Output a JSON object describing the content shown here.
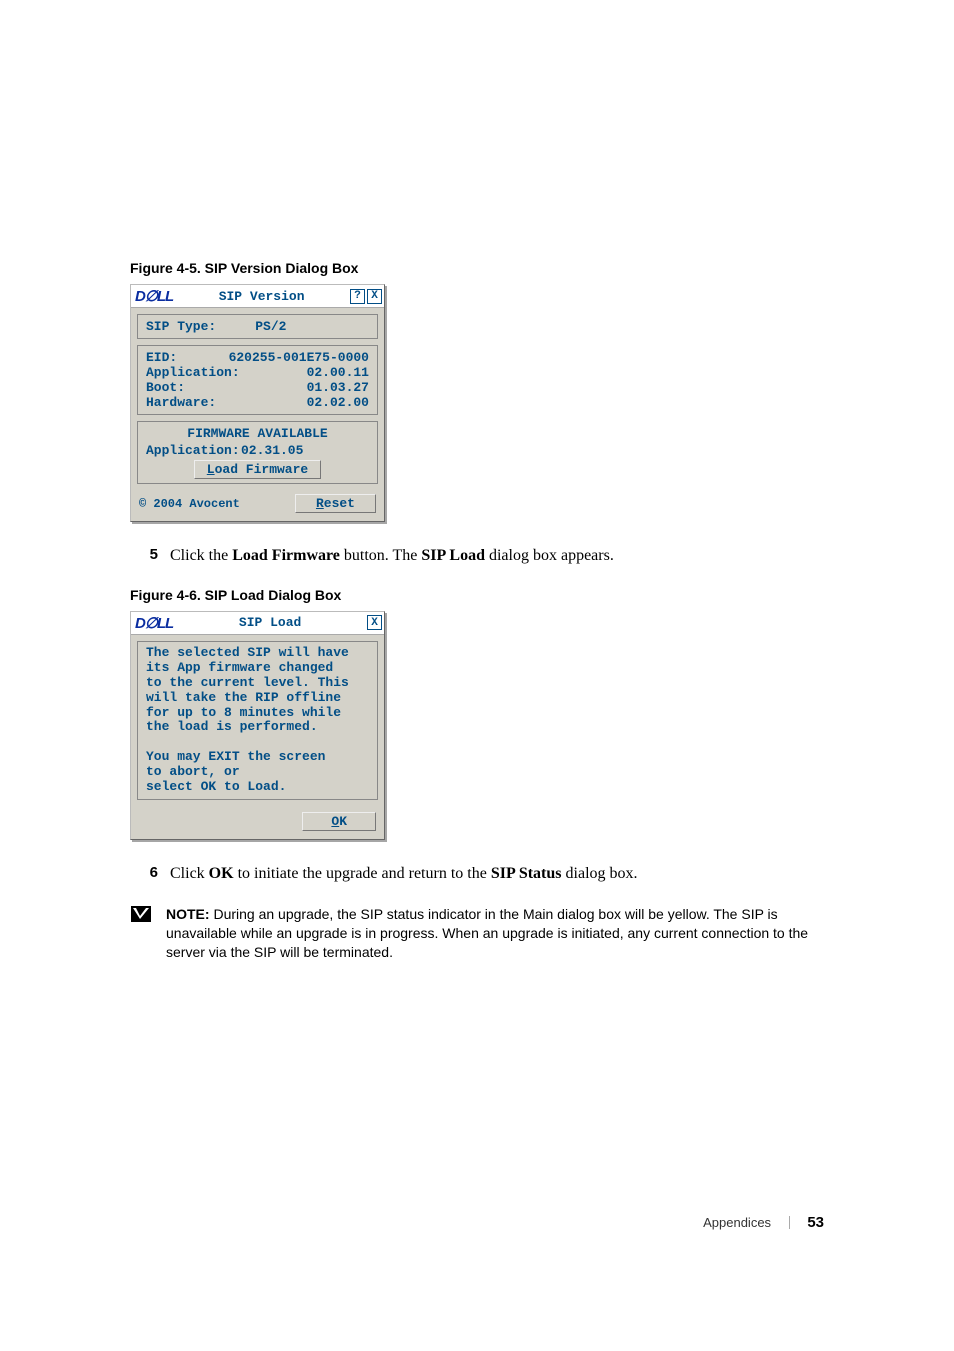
{
  "figure1": {
    "caption": "Figure 4-5.    SIP Version Dialog Box",
    "title": "SIP Version",
    "help_label": "?",
    "close_label": "X",
    "sip_type_label": "SIP Type:",
    "sip_type_value": "PS/2",
    "eid_label": "EID:",
    "eid_value": "620255-001E75-0000",
    "app_label": "Application:",
    "app_value": "02.00.11",
    "boot_label": "Boot:",
    "boot_value": "01.03.27",
    "hw_label": "Hardware:",
    "hw_value": "02.02.00",
    "fw_header": "FIRMWARE AVAILABLE",
    "fw_app_label": "Application:",
    "fw_app_value": "02.31.05",
    "load_btn": "Load Firmware",
    "copyright": "© 2004 Avocent",
    "reset_btn": "Reset"
  },
  "step5": {
    "num": "5",
    "pre": "Click the ",
    "btn": "Load Firmware",
    "mid": " button. The ",
    "dlg": "SIP Load",
    "post": " dialog box appears."
  },
  "figure2": {
    "caption": "Figure 4-6.    SIP Load Dialog Box",
    "title": "SIP Load",
    "close_label": "X",
    "l1": "The selected SIP will have",
    "l2": "its App firmware changed",
    "l3": "to the current level.  This",
    "l4": "will take the RIP offline",
    "l5": "for up to 8 minutes while",
    "l6": "the load is performed.",
    "l7": "You may EXIT the screen",
    "l8": "to abort, or",
    "l9": "select OK to Load.",
    "ok_btn": "OK"
  },
  "step6": {
    "num": "6",
    "pre": "Click ",
    "ok": "OK",
    "mid": " to initiate the upgrade and return to the ",
    "dlg": "SIP Status",
    "post": " dialog box."
  },
  "note": {
    "label": "NOTE: ",
    "text": "During an upgrade, the SIP status indicator in the Main dialog box will be yellow. The SIP is unavailable while an upgrade is in progress. When an upgrade is initiated, any current connection to the server via the SIP will be terminated."
  },
  "footer": {
    "section": "Appendices",
    "page": "53"
  }
}
